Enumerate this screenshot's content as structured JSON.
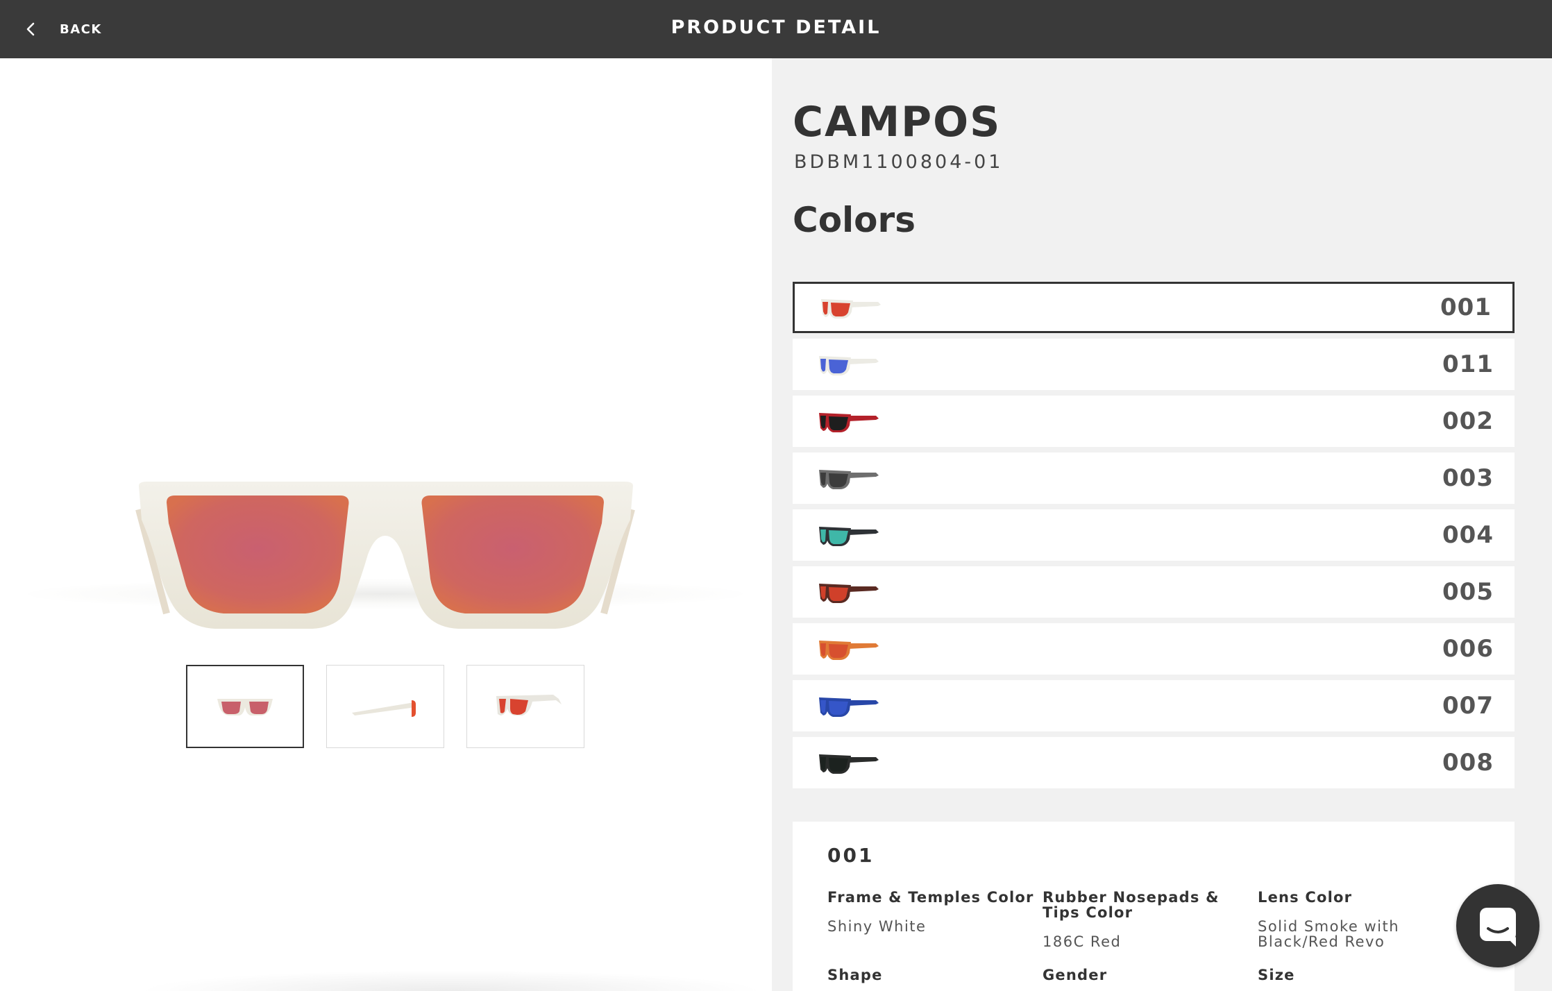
{
  "header": {
    "back_label": "BACK",
    "title": "PRODUCT DETAIL"
  },
  "product": {
    "name": "CAMPOS",
    "sku": "BDBM1100804-01",
    "colors_heading": "Colors"
  },
  "colors": [
    {
      "code": "001",
      "frame": "#ecebe4",
      "lens": "#d8432f",
      "selected": true
    },
    {
      "code": "011",
      "frame": "#ecebe4",
      "lens": "#4a63d6",
      "selected": false
    },
    {
      "code": "002",
      "frame": "#b3212a",
      "lens": "#1e1e1e",
      "selected": false
    },
    {
      "code": "003",
      "frame": "#6e6e6e",
      "lens": "#3c3c3c",
      "selected": false
    },
    {
      "code": "004",
      "frame": "#2e3236",
      "lens": "#3fb7a8",
      "selected": false
    },
    {
      "code": "005",
      "frame": "#5a2a22",
      "lens": "#d0402a",
      "selected": false
    },
    {
      "code": "006",
      "frame": "#e07a36",
      "lens": "#d7502f",
      "selected": false
    },
    {
      "code": "007",
      "frame": "#2847a8",
      "lens": "#3556c9",
      "selected": false
    },
    {
      "code": "008",
      "frame": "#2a2c2b",
      "lens": "#1c221f",
      "selected": false
    }
  ],
  "specs": {
    "code": "001",
    "frame_label": "Frame & Temples Color",
    "frame_value": "Shiny White",
    "nosepads_label": "Rubber Nosepads & Tips Color",
    "nosepads_value": "186C Red",
    "lens_label": "Lens Color",
    "lens_value": "Solid Smoke with Black/Red Revo",
    "shape_label": "Shape",
    "gender_label": "Gender",
    "size_label": "Size"
  }
}
